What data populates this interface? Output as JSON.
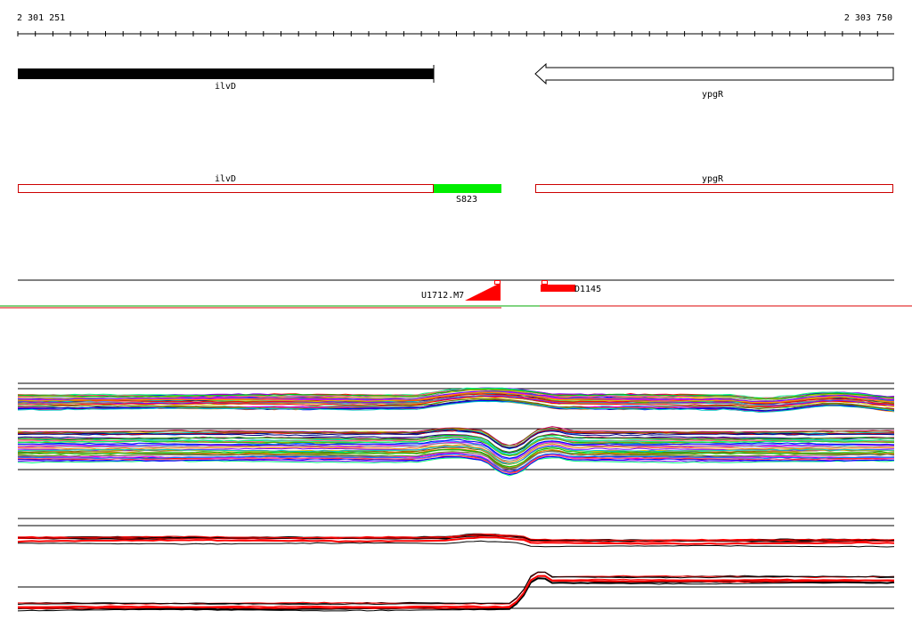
{
  "ruler": {
    "start_label": "2 301 251",
    "end_label": "2 303 750"
  },
  "genes": {
    "ilvD": {
      "label": "ilvD",
      "strand": "+",
      "style": "filled black bar"
    },
    "ypgR": {
      "label": "ypgR",
      "strand": "-",
      "style": "open arrow"
    }
  },
  "segments": {
    "ilvD": {
      "label": "ilvD"
    },
    "ypgR": {
      "label": "ypgR"
    },
    "S823": {
      "label": "S823",
      "color": "#00ee00"
    }
  },
  "features": {
    "U1712": {
      "label": "U1712.M7",
      "color": "#ff0000"
    },
    "D1145": {
      "label": "D1145",
      "color": "#ff0000"
    }
  },
  "colors": {
    "gene_fill": "#000000",
    "segment_outline": "#cc0000",
    "segment_highlight": "#00ee00",
    "feature": "#ff0000",
    "axis": "#000000",
    "separator_left": "#00aa00",
    "separator_right": "#dd0000"
  },
  "tracks": {
    "profile_group_1": {
      "style": "multicolor overlay",
      "line_count": 40
    },
    "profile_group_2": {
      "style": "multicolor overlay",
      "line_count": 45
    },
    "profile_group_3": {
      "style": "black and red overlay"
    },
    "profile_group_4": {
      "style": "black and red overlay"
    }
  }
}
